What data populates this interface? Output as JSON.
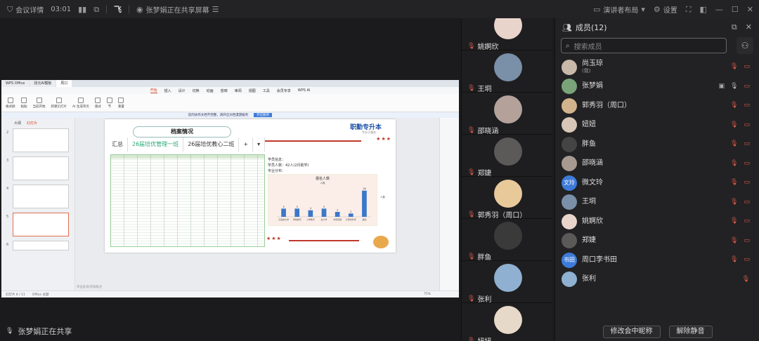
{
  "topbar": {
    "meeting_info_label": "会议详情",
    "timer": "03:01",
    "sharing_notice": "张梦娟正在共享屏幕",
    "layout_label": "演讲者布局",
    "settings_label": "设置"
  },
  "shared_screen": {
    "wps": {
      "tabs": [
        "WPS Office",
        "找元AI模板",
        "周口"
      ],
      "menu": [
        "开始",
        "插入",
        "设计",
        "切换",
        "动画",
        "放映",
        "审阅",
        "视图",
        "工具",
        "会员专享",
        "WPS AI"
      ],
      "active_menu": "开始",
      "ribbon_buttons": [
        "格式刷",
        "粘贴",
        "当前开始",
        "新建幻灯片",
        "AI 生成单页",
        "版式",
        "节",
        "重置"
      ],
      "notice": "您的协作文档不完整，请开启文档漫游服务",
      "notice_action": "开启服务",
      "outline_label": "大纲",
      "slides_label": "幻灯片",
      "thumb_numbers": [
        "2",
        "3",
        "4",
        "5",
        "6"
      ],
      "status_left": "幻灯片 6 / 11",
      "status_office": "Office 主题",
      "status_zoom": "75%",
      "notes_placeholder": "单击此处添加备注"
    },
    "slide": {
      "title": "档案情况",
      "tabs": [
        "汇总",
        "26届培优管理一班",
        "26届培优教心二班",
        "+",
        "▾"
      ],
      "logo_text": "职勤专升本",
      "logo_sub": "专业于服务",
      "info_line1": "学员信息：",
      "info_line2": "学员人数：42人(2月助学)",
      "info_line3": "专业分布：",
      "chart_side_label": "人数"
    }
  },
  "chart_data": {
    "type": "bar",
    "title": "报名人数",
    "legend": [
      "人数"
    ],
    "categories": [
      "汉语言文学",
      "学前教育",
      "小学教育",
      "会计学",
      "市场营销",
      "计算机科学",
      "其他"
    ],
    "values": [
      5,
      5,
      4,
      5,
      3,
      2,
      16
    ],
    "ylim": [
      0,
      18
    ]
  },
  "sharing_status": "张梦娟正在共享",
  "video_tiles": [
    {
      "name": "姚婀欣",
      "color": "#e9d4cc"
    },
    {
      "name": "王垌",
      "color": "#7a8fa8"
    },
    {
      "name": "邵晓涵",
      "color": "#b4a29a"
    },
    {
      "name": "郑婕",
      "color": "#5c5a58"
    },
    {
      "name": "郭秀羽（周口）",
      "color": "#e8c99a"
    },
    {
      "name": "胖鱼",
      "color": "#3a3a3a"
    },
    {
      "name": "张利",
      "color": "#8fb0d0"
    },
    {
      "name": "妞妞",
      "color": "#e7d9c9"
    }
  ],
  "members_panel": {
    "title": "成员(12)",
    "search_placeholder": "搜索成员",
    "members": [
      {
        "name": "尚玉琼",
        "sub": "(我)",
        "avatar_color": "#c9b9a9",
        "avatar_text": "",
        "icons": [
          "mic-off",
          "cam-off"
        ]
      },
      {
        "name": "张梦娟",
        "sub": "",
        "avatar_color": "#7aa37a",
        "avatar_text": "",
        "icons": [
          "screen",
          "mic-on",
          "cam-off"
        ]
      },
      {
        "name": "郭秀羽（周口）",
        "sub": "",
        "avatar_color": "#d2b48c",
        "avatar_text": "",
        "icons": [
          "mic-off",
          "cam-off"
        ]
      },
      {
        "name": "妞妞",
        "sub": "",
        "avatar_color": "#d8c6b6",
        "avatar_text": "",
        "icons": [
          "mic-off",
          "cam-off"
        ]
      },
      {
        "name": "胖鱼",
        "sub": "",
        "avatar_color": "#444444",
        "avatar_text": "",
        "icons": [
          "mic-off",
          "cam-off"
        ]
      },
      {
        "name": "邵晓涵",
        "sub": "",
        "avatar_color": "#a89a90",
        "avatar_text": "",
        "icons": [
          "mic-off",
          "cam-off"
        ]
      },
      {
        "name": "微文玲",
        "sub": "",
        "avatar_color": "#3d7bd9",
        "avatar_text": "文玲",
        "icons": [
          "mic-off",
          "cam-off"
        ]
      },
      {
        "name": "王垌",
        "sub": "",
        "avatar_color": "#7a8fa8",
        "avatar_text": "",
        "icons": [
          "mic-off",
          "cam-off"
        ]
      },
      {
        "name": "姚婀欣",
        "sub": "",
        "avatar_color": "#e9d4cc",
        "avatar_text": "",
        "icons": [
          "mic-off",
          "cam-off"
        ]
      },
      {
        "name": "郑婕",
        "sub": "",
        "avatar_color": "#5c5a58",
        "avatar_text": "",
        "icons": [
          "mic-off",
          "cam-off"
        ]
      },
      {
        "name": "周口李书田",
        "sub": "",
        "avatar_color": "#3d7bd9",
        "avatar_text": "书田",
        "icons": [
          "mic-off",
          "cam-off"
        ]
      },
      {
        "name": "张利",
        "sub": "",
        "avatar_color": "#8fb0d0",
        "avatar_text": "",
        "icons": [
          "mic-off"
        ]
      }
    ],
    "rename_button": "修改会中昵称",
    "unmute_button": "解除静音"
  },
  "colors": {
    "mic_off": "#e05a4a",
    "accent_green": "#2aa876",
    "bar_blue": "#3a78c9"
  }
}
